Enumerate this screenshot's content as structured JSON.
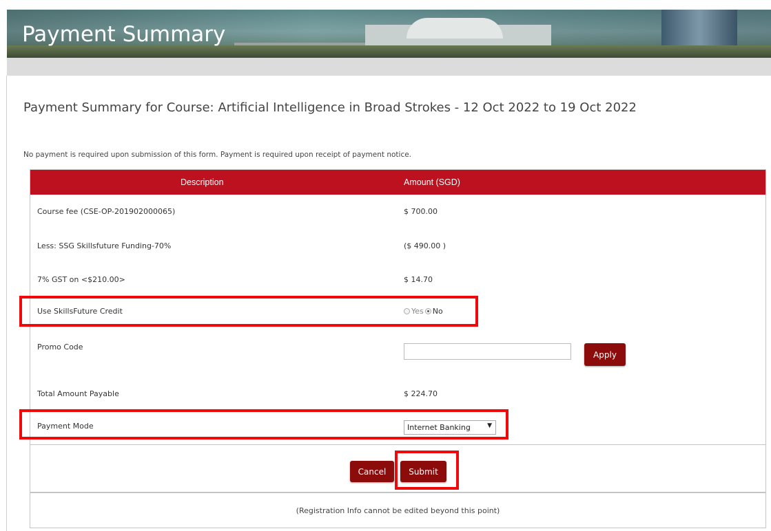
{
  "banner": {
    "title": "Payment Summary"
  },
  "heading": "Payment Summary for Course: Artificial Intelligence in Broad Strokes - 12 Oct 2022 to 19 Oct 2022",
  "note": "No payment is required upon submission of this form. Payment is required upon receipt of payment notice.",
  "table": {
    "headers": {
      "description": "Description",
      "amount": "Amount (SGD)"
    },
    "rows": [
      {
        "label": "Course fee (CSE-OP-201902000065)",
        "value": "$ 700.00"
      },
      {
        "label": "Less: SSG Skillsfuture Funding-70%",
        "value": "($ 490.00 )"
      },
      {
        "label": "7% GST on <$210.00>",
        "value": "$ 14.70"
      }
    ],
    "skillsfuture": {
      "label": "Use SkillsFuture Credit",
      "yes": "Yes",
      "no": "No",
      "selected": "No"
    },
    "promo": {
      "label": "Promo Code",
      "value": "",
      "apply": "Apply"
    },
    "total": {
      "label": "Total Amount Payable",
      "value": "$ 224.70"
    },
    "payment_mode": {
      "label": "Payment Mode",
      "selected": "Internet Banking",
      "arrow": "▼"
    }
  },
  "actions": {
    "cancel": "Cancel",
    "submit": "Submit"
  },
  "footer": "(Registration Info cannot be edited beyond this point)",
  "colors": {
    "header_red": "#bd1120",
    "button_maroon": "#8c0c0c",
    "highlight_red": "#ee0a0a"
  }
}
